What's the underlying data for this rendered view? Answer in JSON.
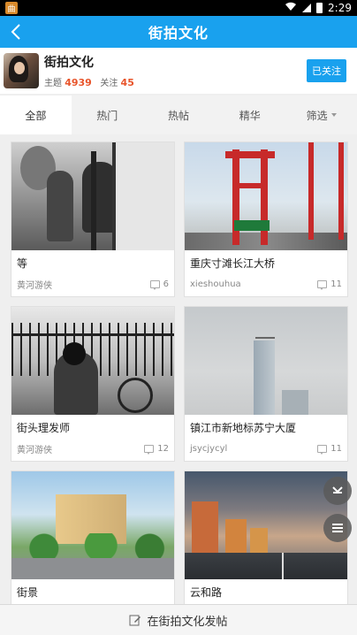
{
  "status_bar": {
    "app_badge": "曲",
    "time": "2:29"
  },
  "nav": {
    "title": "街拍文化"
  },
  "forum": {
    "name": "街拍文化",
    "topics_label": "主题",
    "topics_count": "4939",
    "following_label": "关注",
    "following_count": "45",
    "follow_button": "已关注"
  },
  "tabs": [
    {
      "label": "全部"
    },
    {
      "label": "热门"
    },
    {
      "label": "热帖"
    },
    {
      "label": "精华"
    },
    {
      "label": "筛选"
    }
  ],
  "posts": [
    {
      "title": "等",
      "author": "黄河游侠",
      "comments": "6"
    },
    {
      "title": "重庆寸滩长江大桥",
      "author": "xieshouhua",
      "comments": "11"
    },
    {
      "title": "街头理发师",
      "author": "黄河游侠",
      "comments": "12"
    },
    {
      "title": "镇江市新地标苏宁大厦",
      "author": "jsycjycyl",
      "comments": "11"
    },
    {
      "title": "街景",
      "author": "",
      "comments": ""
    },
    {
      "title": "云和路",
      "author": "",
      "comments": ""
    }
  ],
  "post_bar": {
    "label": "在街拍文化发帖"
  },
  "colors": {
    "primary": "#19a1ee",
    "accent": "#e8542a"
  }
}
